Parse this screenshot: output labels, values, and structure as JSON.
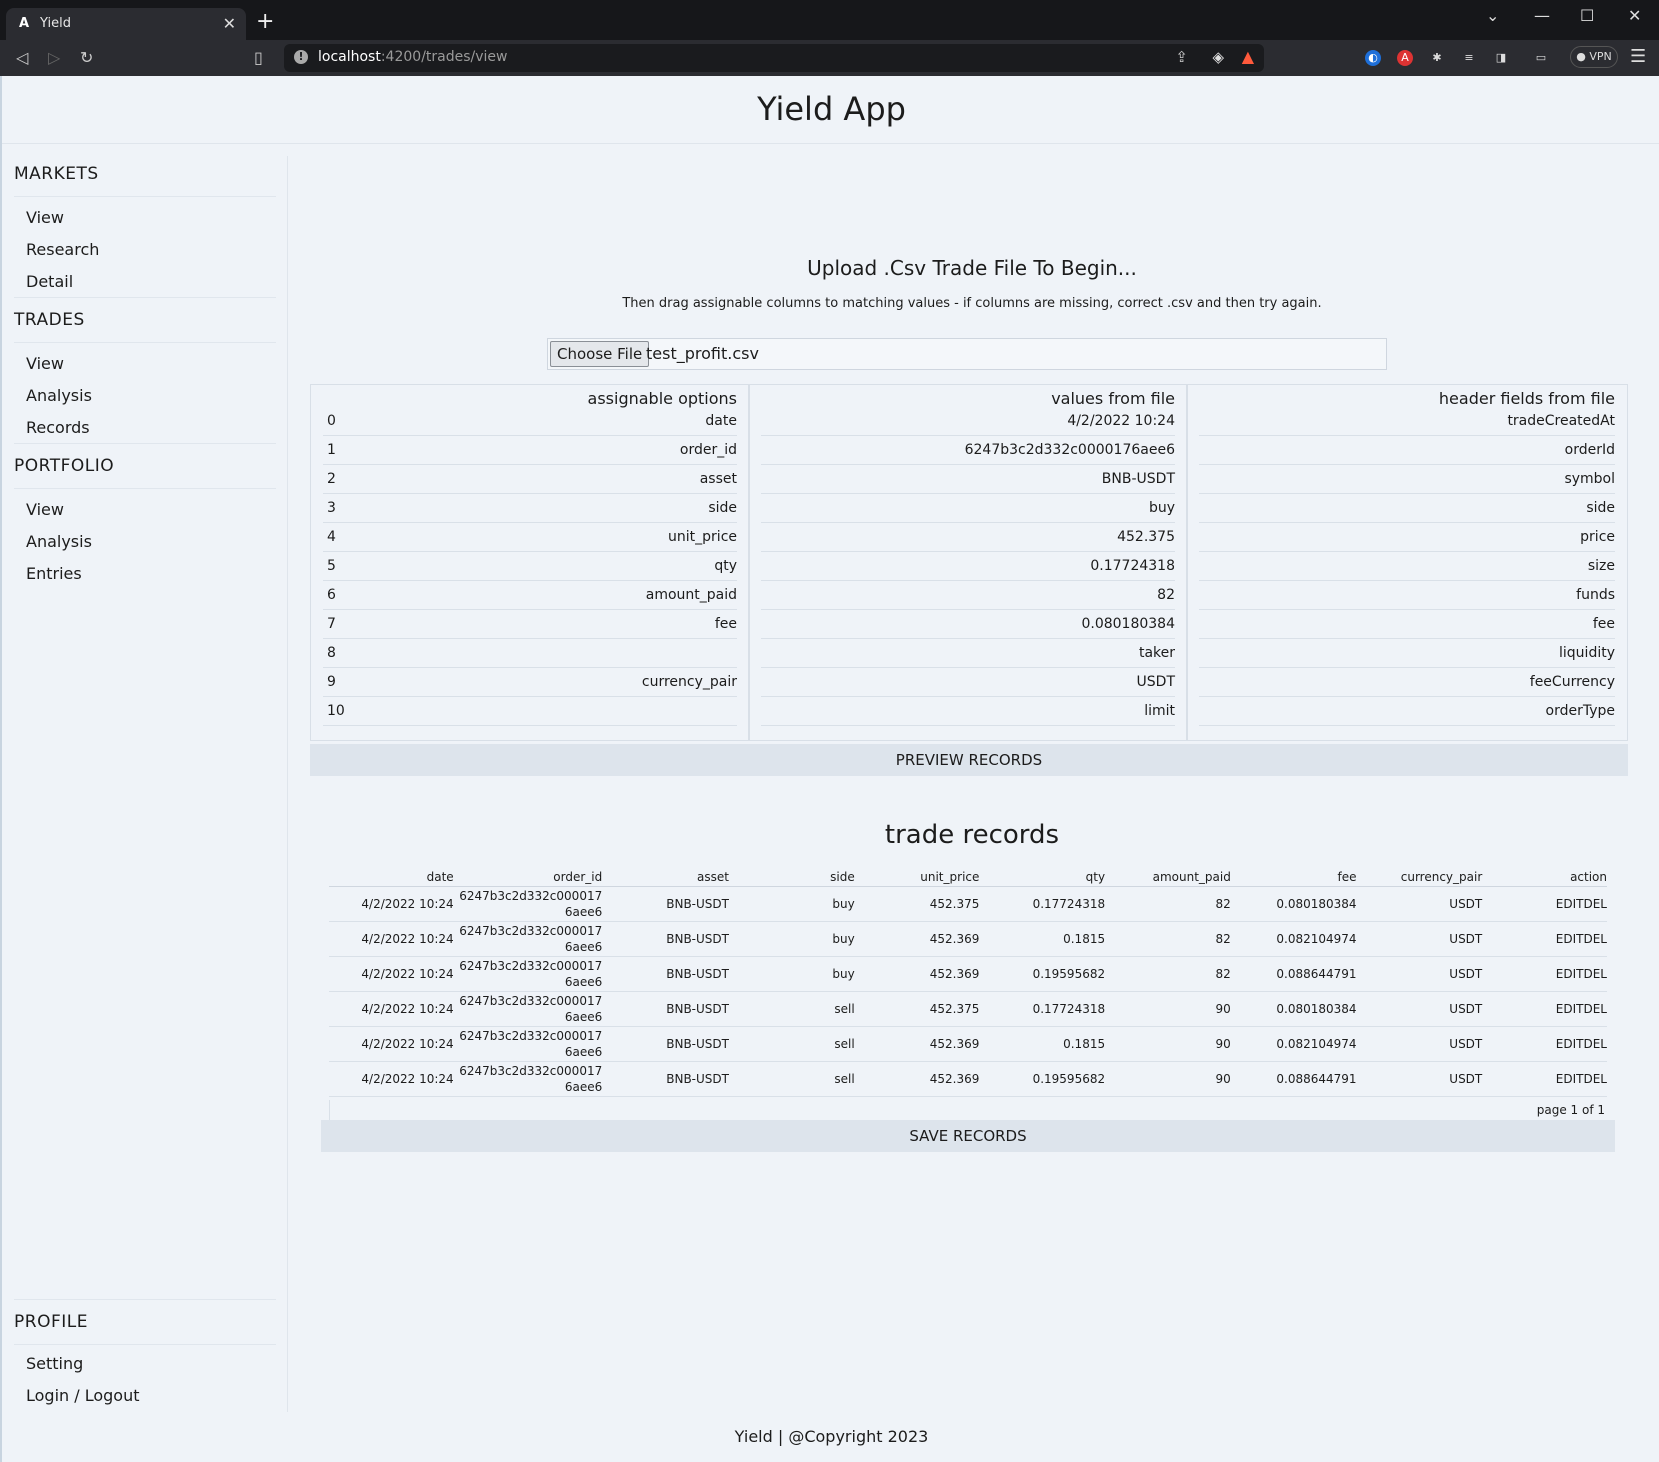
{
  "browser": {
    "tab_title": "Yield",
    "url_host": "localhost",
    "url_rest": ":4200/trades/view",
    "vpn_label": "VPN"
  },
  "app": {
    "title": "Yield App",
    "footer": "Yield | @Copyright 2023"
  },
  "sidebar": {
    "markets": {
      "title": "MARKETS",
      "items": [
        "View",
        "Research",
        "Detail"
      ]
    },
    "trades": {
      "title": "TRADES",
      "items": [
        "View",
        "Analysis",
        "Records"
      ]
    },
    "portfolio": {
      "title": "PORTFOLIO",
      "items": [
        "View",
        "Analysis",
        "Entries"
      ]
    },
    "profile": {
      "title": "PROFILE",
      "items": [
        "Setting",
        "Login / Logout"
      ]
    }
  },
  "upload": {
    "title": "Upload .Csv Trade File To Begin...",
    "subtitle": "Then drag assignable columns to matching values - if columns are missing, correct .csv and then try again.",
    "choose_label": "Choose File",
    "file_name": "test_profit.csv"
  },
  "mapper": {
    "headers": [
      "assignable options",
      "values from file",
      "header fields from file"
    ],
    "indices": [
      "0",
      "1",
      "2",
      "3",
      "4",
      "5",
      "6",
      "7",
      "8",
      "9",
      "10"
    ],
    "options": [
      "date",
      "order_id",
      "asset",
      "side",
      "unit_price",
      "qty",
      "amount_paid",
      "fee",
      "",
      "currency_pair",
      ""
    ],
    "values": [
      "4/2/2022 10:24",
      "6247b3c2d332c0000176aee6",
      "BNB-USDT",
      "buy",
      "452.375",
      "0.17724318",
      "82",
      "0.080180384",
      "taker",
      "USDT",
      "limit"
    ],
    "fields": [
      "tradeCreatedAt",
      "orderId",
      "symbol",
      "side",
      "price",
      "size",
      "funds",
      "fee",
      "liquidity",
      "feeCurrency",
      "orderType"
    ]
  },
  "preview_label": "PREVIEW RECORDS",
  "records": {
    "title": "trade records",
    "columns": [
      "date",
      "order_id",
      "asset",
      "side",
      "unit_price",
      "qty",
      "amount_paid",
      "fee",
      "currency_pair",
      "action"
    ],
    "rows": [
      [
        "4/2/2022 10:24",
        "6247b3c2d332c000017",
        "6aee6",
        "BNB-USDT",
        "buy",
        "452.375",
        "0.17724318",
        "82",
        "0.080180384",
        "USDT",
        "EDITDEL"
      ],
      [
        "4/2/2022 10:24",
        "6247b3c2d332c000017",
        "6aee6",
        "BNB-USDT",
        "buy",
        "452.369",
        "0.1815",
        "82",
        "0.082104974",
        "USDT",
        "EDITDEL"
      ],
      [
        "4/2/2022 10:24",
        "6247b3c2d332c000017",
        "6aee6",
        "BNB-USDT",
        "buy",
        "452.369",
        "0.19595682",
        "82",
        "0.088644791",
        "USDT",
        "EDITDEL"
      ],
      [
        "4/2/2022 10:24",
        "6247b3c2d332c000017",
        "6aee6",
        "BNB-USDT",
        "sell",
        "452.375",
        "0.17724318",
        "90",
        "0.080180384",
        "USDT",
        "EDITDEL"
      ],
      [
        "4/2/2022 10:24",
        "6247b3c2d332c000017",
        "6aee6",
        "BNB-USDT",
        "sell",
        "452.369",
        "0.1815",
        "90",
        "0.082104974",
        "USDT",
        "EDITDEL"
      ],
      [
        "4/2/2022 10:24",
        "6247b3c2d332c000017",
        "6aee6",
        "BNB-USDT",
        "sell",
        "452.369",
        "0.19595682",
        "90",
        "0.088644791",
        "USDT",
        "EDITDEL"
      ]
    ],
    "pager": "page 1 of 1",
    "save_label": "SAVE RECORDS"
  }
}
